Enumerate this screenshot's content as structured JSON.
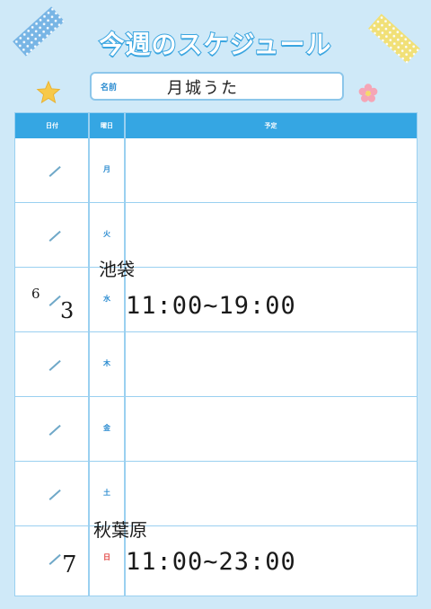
{
  "title": "今週のスケジュール",
  "name": {
    "label": "名前",
    "value": "月城うた"
  },
  "columns": {
    "date": "日付",
    "weekday": "曜日",
    "plan": "予定"
  },
  "rows": [
    {
      "weekday": "月",
      "date_sep": "/"
    },
    {
      "weekday": "火",
      "date_sep": "/"
    },
    {
      "weekday": "水",
      "date_sep": "/",
      "month": "6",
      "day": "3",
      "place": "池袋",
      "time": "11:00~19:00"
    },
    {
      "weekday": "木",
      "date_sep": "/"
    },
    {
      "weekday": "金",
      "date_sep": "/"
    },
    {
      "weekday": "土",
      "date_sep": "/"
    },
    {
      "weekday": "日",
      "date_sep": "/",
      "day": "7",
      "place": "秋葉原",
      "time": "11:00~23:00"
    }
  ],
  "colors": {
    "background": "#cfe9f8",
    "header": "#35a6e3",
    "grid": "#9ad0f0",
    "sunday": "#e2413f",
    "weekday_text": "#2a8bd0"
  }
}
